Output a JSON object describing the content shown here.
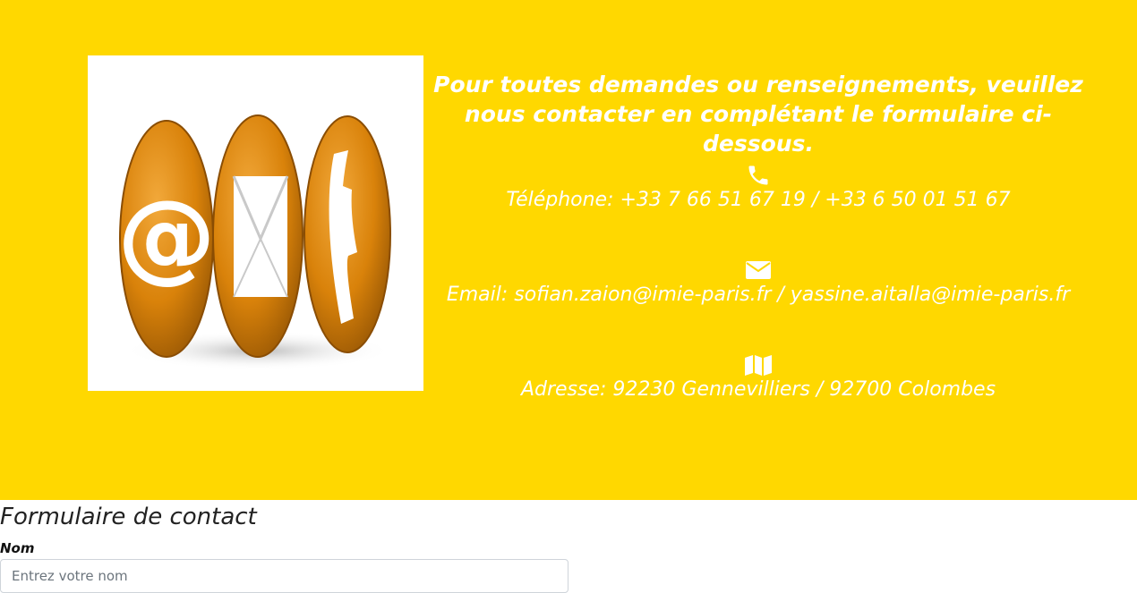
{
  "hero": {
    "intro": "Pour toutes demandes ou renseignements, veuillez nous contacter en complétant le formulaire ci-dessous.",
    "phone": {
      "icon": "phone-icon",
      "text": "Téléphone: +33 7 66 51 67 19 / +33 6 50 01 51 67"
    },
    "email": {
      "icon": "envelope-icon",
      "text": "Email: sofian.zaion@imie-paris.fr / yassine.aitalla@imie-paris.fr"
    },
    "address": {
      "icon": "map-icon",
      "text": "Adresse: 92230 Gennevilliers / 92700 Colombes"
    },
    "background_color": "#FFD800",
    "image_accent_color": "#D9820A"
  },
  "form": {
    "title": "Formulaire de contact",
    "name_label": "Nom",
    "name_placeholder": "Entrez votre nom",
    "name_value": ""
  }
}
